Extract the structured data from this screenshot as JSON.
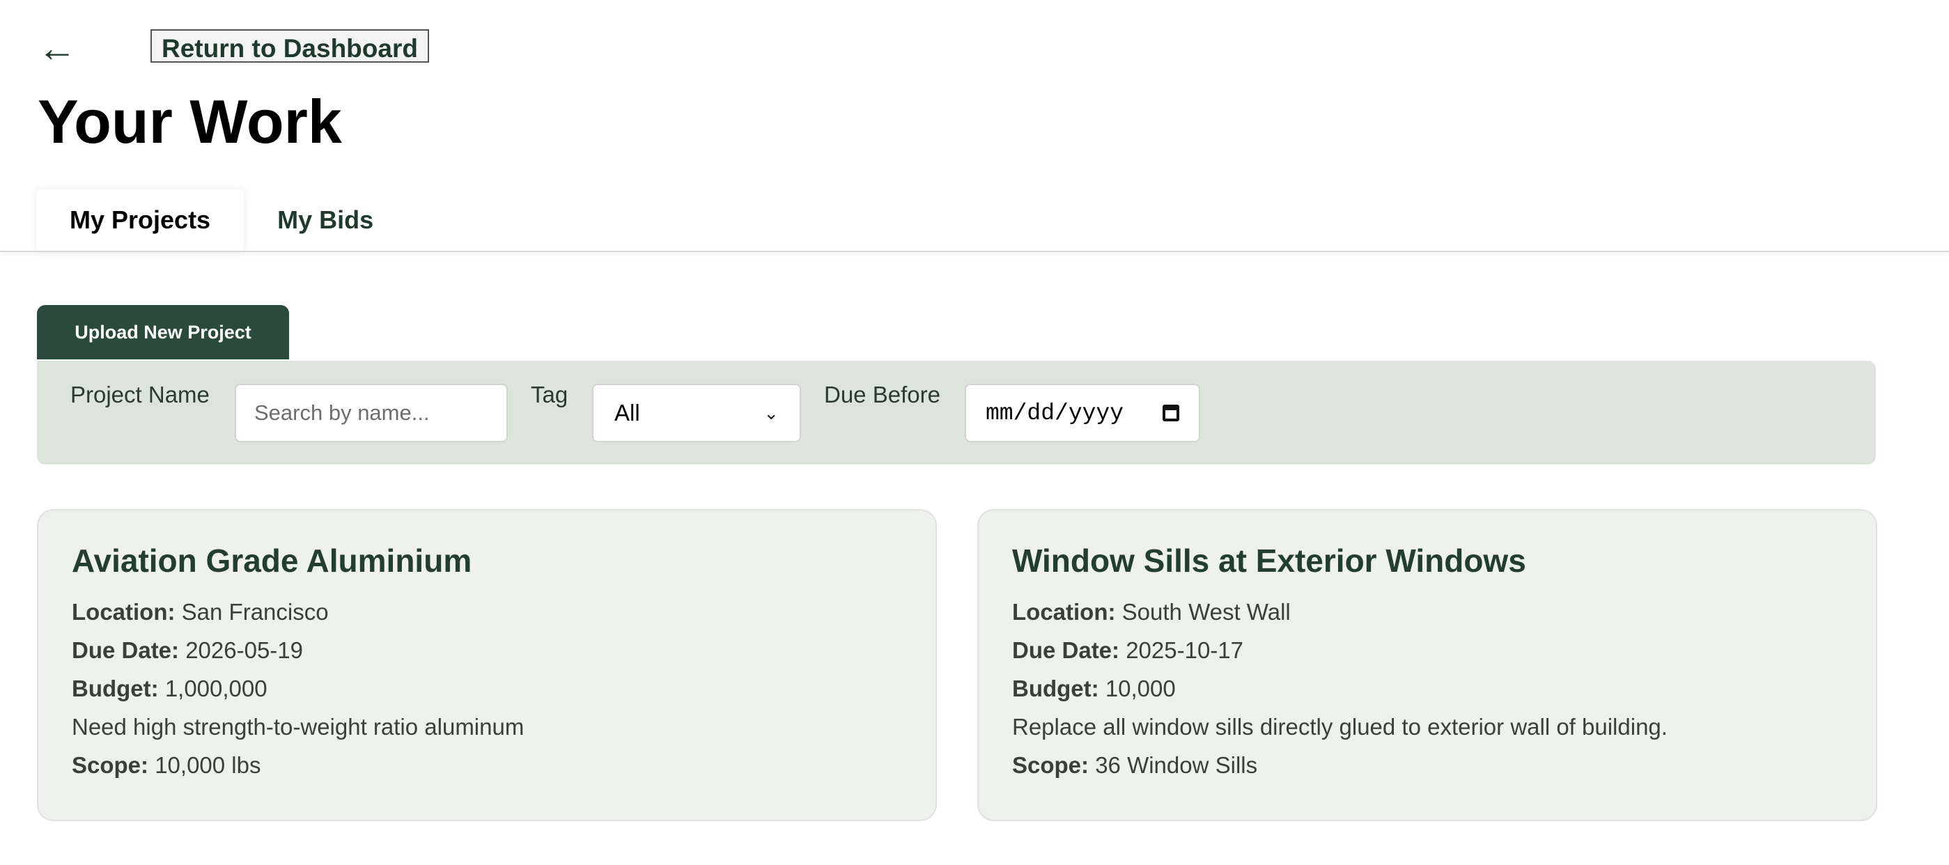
{
  "nav": {
    "back_icon": "←",
    "return_label": "Return to Dashboard"
  },
  "page": {
    "title": "Your Work"
  },
  "tabs": [
    {
      "label": "My Projects",
      "active": true
    },
    {
      "label": "My Bids",
      "active": false
    }
  ],
  "actions": {
    "upload_label": "Upload New Project"
  },
  "filters": {
    "name_label": "Project Name",
    "name_placeholder": "Search by name...",
    "tag_label": "Tag",
    "tag_value": "All",
    "due_label": "Due Before",
    "due_placeholder": "mm/dd/yyyy"
  },
  "field_labels": {
    "location": "Location:",
    "due": "Due Date:",
    "budget": "Budget:",
    "scope": "Scope:"
  },
  "projects": [
    {
      "title": "Aviation Grade Aluminium",
      "location": "San Francisco",
      "due_date": "2026-05-19",
      "budget": "1,000,000",
      "description": "Need high strength-to-weight ratio aluminum",
      "scope": "10,000 lbs"
    },
    {
      "title": "Window Sills at Exterior Windows",
      "location": "South West Wall",
      "due_date": "2025-10-17",
      "budget": "10,000",
      "description": "Replace all window sills directly glued to exterior wall of building.",
      "scope": "36 Window Sills"
    }
  ],
  "colors": {
    "accent": "#2a4a3c",
    "filter_bg": "#dde4dc",
    "card_bg": "#eff1ee"
  }
}
